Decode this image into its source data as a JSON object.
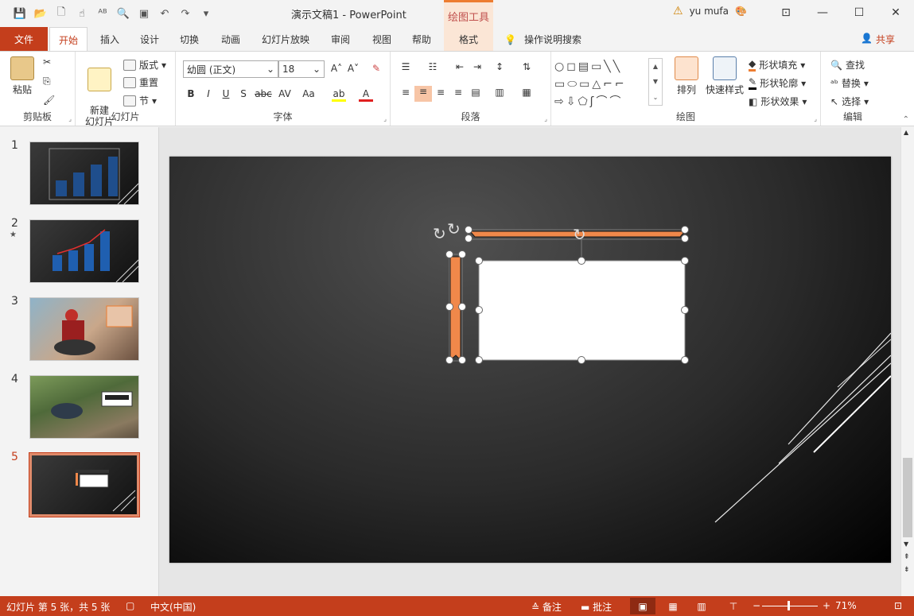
{
  "title_bar": {
    "doc_title": "演示文稿1  -  PowerPoint",
    "context_tab_title": "绘图工具",
    "user_name": "yu mufa"
  },
  "tabs": [
    "文件",
    "开始",
    "插入",
    "设计",
    "切换",
    "动画",
    "幻灯片放映",
    "审阅",
    "视图",
    "帮助",
    "格式"
  ],
  "tell_me": "操作说明搜索",
  "share": "共享",
  "ribbon": {
    "clipboard": {
      "label": "剪贴板",
      "paste": "粘贴"
    },
    "slides": {
      "label": "幻灯片",
      "new_slide": "新建\n幻灯片",
      "layout": "版式",
      "reset": "重置",
      "section": "节"
    },
    "font": {
      "label": "字体",
      "font_name": "幼圆 (正文)",
      "font_size": "18"
    },
    "paragraph": {
      "label": "段落"
    },
    "drawing": {
      "label": "绘图",
      "arrange": "排列",
      "quick_styles": "快速样式",
      "fill": "形状填充",
      "outline": "形状轮廓",
      "effects": "形状效果"
    },
    "editing": {
      "label": "编辑",
      "find": "查找",
      "replace": "替换",
      "select": "选择"
    }
  },
  "thumbnails": [
    {
      "num": "1",
      "star": ""
    },
    {
      "num": "2",
      "star": "★"
    },
    {
      "num": "3",
      "star": ""
    },
    {
      "num": "4",
      "star": ""
    },
    {
      "num": "5",
      "star": ""
    }
  ],
  "status_bar": {
    "slide_info": "幻灯片 第 5 张，共 5 张",
    "language": "中文(中国)",
    "notes": "备注",
    "comments": "批注",
    "zoom": "71%"
  },
  "colors": {
    "accent": "#c43e1c",
    "shape_orange": "#f0884a",
    "context_tab": "#fbe6d6"
  }
}
